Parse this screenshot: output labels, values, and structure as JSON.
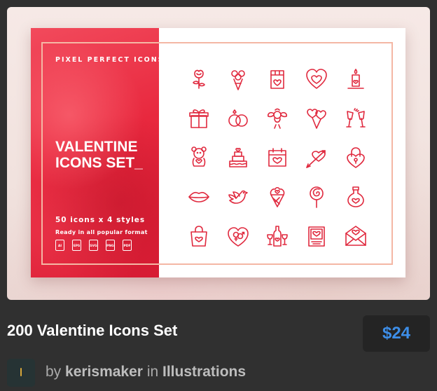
{
  "banner": {
    "kicker": "PIXEL PERFECT ICONS",
    "title_line1": "VALENTINE",
    "title_line2": "ICONS SET_",
    "count": "50 icons x 4 styles",
    "format_note": "Ready in all popular format",
    "formats": [
      "AI",
      "EPS",
      "SVG",
      "PNG",
      "PDF"
    ],
    "accent_color": "#e0293e",
    "frame_color": "#f4b7a4",
    "icons": [
      "rose-icon",
      "bouquet-icon",
      "chocolate-bar-icon",
      "heart-cookie-icon",
      "candle-icon",
      "gift-box-icon",
      "wedding-rings-icon",
      "cupid-icon",
      "heart-balloons-icon",
      "champagne-glasses-icon",
      "teddy-bear-icon",
      "wedding-cake-icon",
      "calendar-heart-icon",
      "heart-arrow-icon",
      "heart-padlock-icon",
      "lips-icon",
      "dove-icon",
      "ice-cream-cone-icon",
      "lollipop-icon",
      "love-potion-icon",
      "shopping-bag-icon",
      "gender-symbols-icon",
      "wine-bottle-glasses-icon",
      "valentine-card-icon",
      "love-letter-icon"
    ]
  },
  "product": {
    "title": "200 Valentine Icons Set",
    "price": "$24",
    "price_color": "#3d8ee8"
  },
  "author": {
    "by": "by",
    "name": "kerismaker",
    "in": "in",
    "category": "Illustrations"
  }
}
